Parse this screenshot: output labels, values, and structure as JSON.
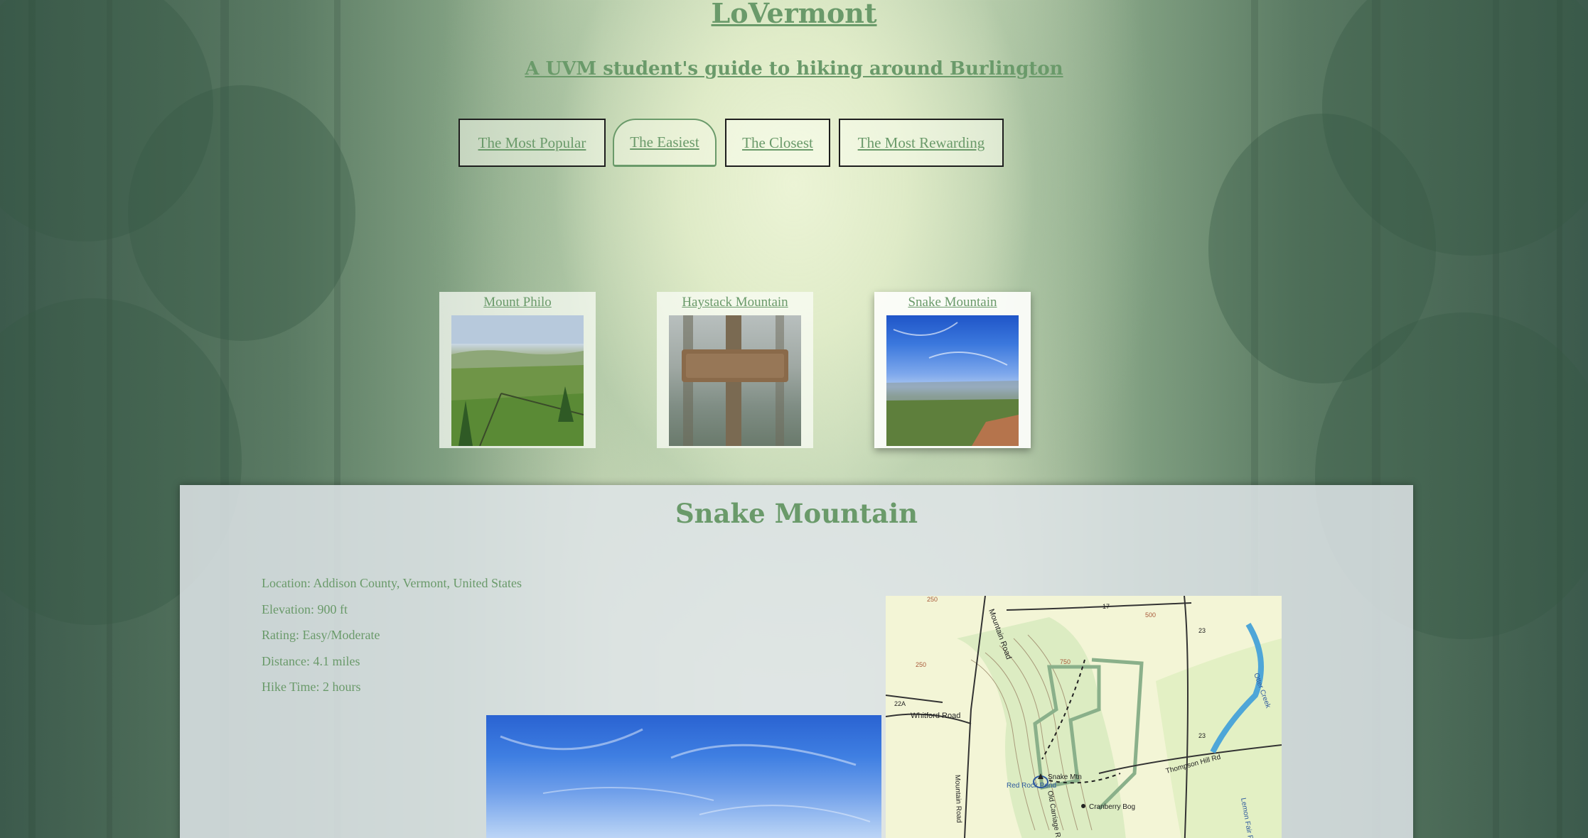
{
  "header": {
    "title": "LoVermont",
    "subtitle": "A UVM student's guide to hiking around Burlington"
  },
  "nav": {
    "items": [
      {
        "label": "The Most Popular"
      },
      {
        "label": "The Easiest"
      },
      {
        "label": "The Closest"
      },
      {
        "label": "The Most Rewarding"
      }
    ],
    "active": "The Easiest"
  },
  "trails": {
    "cards": [
      {
        "label": "Mount Philo"
      },
      {
        "label": "Haystack Mountain"
      },
      {
        "label": "Snake Mountain"
      }
    ],
    "selected": "Snake Mountain"
  },
  "detail": {
    "title": "Snake Mountain",
    "stats": [
      "Location: Addison County, Vermont, United States",
      "Elevation: 900 ft",
      "Rating: Easy/Moderate",
      "Distance: 4.1 miles",
      "Hike Time: 2 hours"
    ],
    "map": {
      "labels": {
        "mountain_road": "Mountain Road",
        "whitford_road": "Whitford Road",
        "snake_mtn": "Snake Mtn",
        "cranberry_bog": "Cranberry Bog",
        "thompson_hill_rd": "Thompson Hill Rd",
        "red_rock_pond": "Red Rock Pond",
        "otter_creek": "Otter Creek",
        "lemon_fair": "Lemon Fair R",
        "old_carriage": "Old Carriage R",
        "route_17": "17",
        "route_23a": "23",
        "route_23b": "23",
        "route_22a": "22A",
        "elev_250": "250",
        "elev_500": "500",
        "elev_750": "750"
      }
    }
  },
  "colors": {
    "accent_green": "#6a9a6a",
    "nav_border": "#1e1e1e"
  }
}
